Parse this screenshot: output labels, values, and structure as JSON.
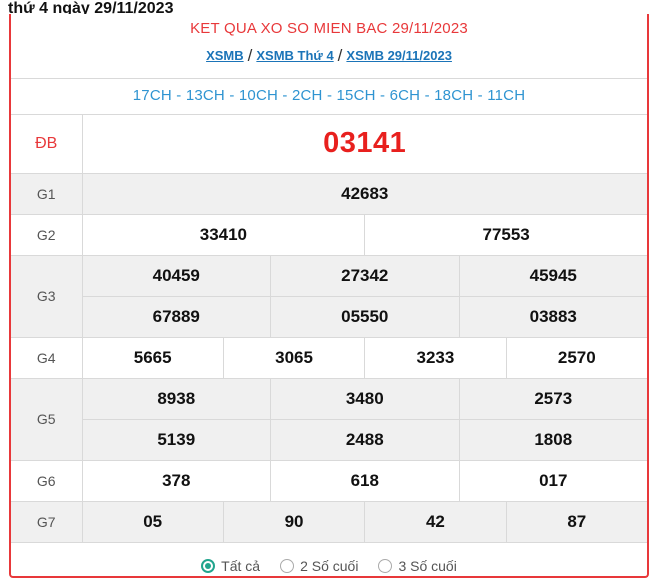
{
  "page_title": "thứ 4 ngày 29/11/2023",
  "header": {
    "title": "KET QUA XO SO MIEN BAC 29/11/2023",
    "breadcrumbs": [
      "XSMB",
      "XSMB Thứ 4",
      "XSMB 29/11/2023"
    ],
    "separator": "/"
  },
  "codes": "17CH - 13CH - 10CH - 2CH - 15CH - 6CH - 18CH - 11CH",
  "prizes": {
    "db": {
      "label": "ĐB",
      "values": [
        "03141"
      ]
    },
    "g1": {
      "label": "G1",
      "values": [
        "42683"
      ]
    },
    "g2": {
      "label": "G2",
      "values": [
        "33410",
        "77553"
      ]
    },
    "g3": {
      "label": "G3",
      "values": [
        "40459",
        "27342",
        "45945",
        "67889",
        "05550",
        "03883"
      ]
    },
    "g4": {
      "label": "G4",
      "values": [
        "5665",
        "3065",
        "3233",
        "2570"
      ]
    },
    "g5": {
      "label": "G5",
      "values": [
        "8938",
        "3480",
        "2573",
        "5139",
        "2488",
        "1808"
      ]
    },
    "g6": {
      "label": "G6",
      "values": [
        "378",
        "618",
        "017"
      ]
    },
    "g7": {
      "label": "G7",
      "values": [
        "05",
        "90",
        "42",
        "87"
      ]
    }
  },
  "filters": {
    "selected": 0,
    "options": [
      "Tất cả",
      "2 Số cuối",
      "3 Số cuối"
    ]
  },
  "colors": {
    "accent": "#e8383a",
    "link": "#1b74b8",
    "codes": "#2f94d1",
    "radio": "#22a58e"
  }
}
